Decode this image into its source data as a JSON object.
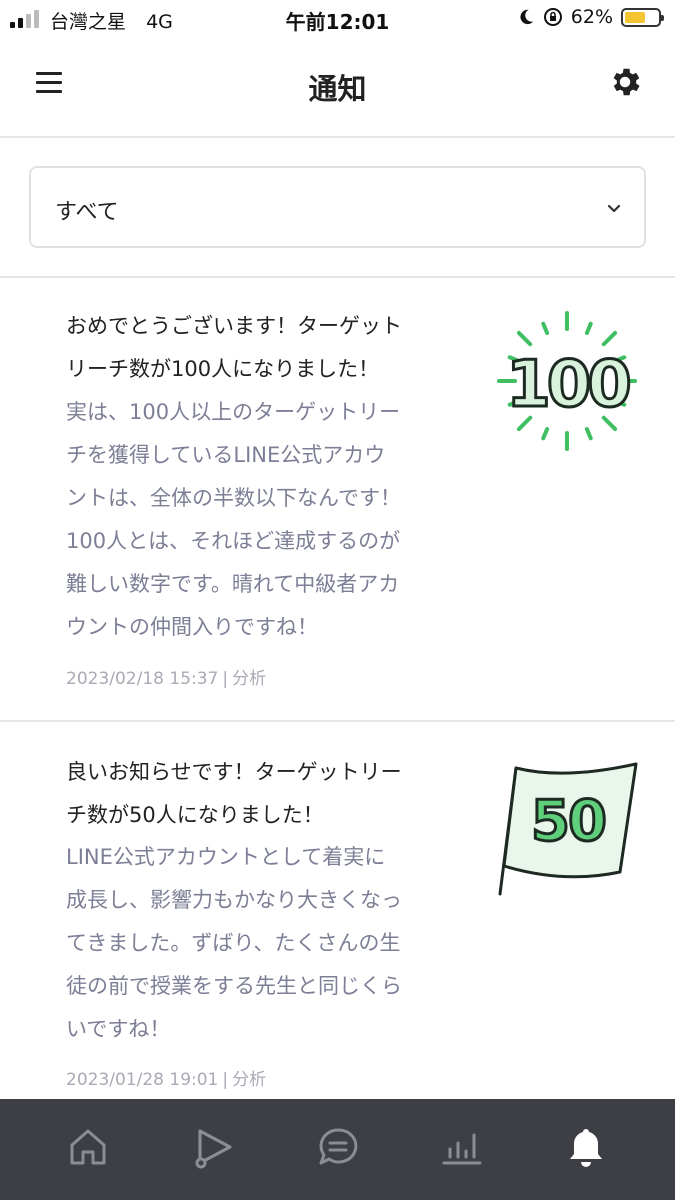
{
  "status_bar": {
    "carrier": "台灣之星",
    "network": "4G",
    "time": "午前12:01",
    "battery_percent": "62%",
    "battery_level": 0.62
  },
  "header": {
    "title": "通知",
    "menu_icon": "hamburger-menu-icon",
    "settings_icon": "gear-icon"
  },
  "filter": {
    "selected": "すべて"
  },
  "notifications": [
    {
      "title_lines": [
        "おめでとうございます！ターゲット",
        "リーチ数が100人になりました！"
      ],
      "body_lines": [
        "実は、100人以上のターゲットリー",
        "チを獲得しているLINE公式アカウ",
        "ントは、全体の半数以下なんです！",
        "100人とは、それほど達成するのが",
        "難しい数字です。晴れて中級者アカ",
        "ウントの仲間入りですね！"
      ],
      "date": "2023/02/18 15:37",
      "category": "分析",
      "badge_text": "100"
    },
    {
      "title_lines": [
        "良いお知らせです！ターゲットリー",
        "チ数が50人になりました！"
      ],
      "body_lines": [
        "LINE公式アカウントとして着実に",
        "成長し、影響力もかなり大きくなっ",
        "てきました。ずばり、たくさんの生",
        "徒の前で授業をする先生と同じくら",
        "いですね！"
      ],
      "date": "2023/01/28 19:01",
      "category": "分析",
      "badge_text": "50"
    }
  ],
  "bottom_nav": {
    "items": [
      {
        "icon": "home-icon",
        "active": false
      },
      {
        "icon": "play-icon",
        "active": false
      },
      {
        "icon": "chat-icon",
        "active": false
      },
      {
        "icon": "analytics-icon",
        "active": false
      },
      {
        "icon": "bell-icon",
        "active": true
      }
    ]
  },
  "colors": {
    "accent_green": "#3fbf62",
    "badge_fill": "#d8f2dc",
    "body_text": "#7c7f96",
    "meta_text": "#a8abb5",
    "nav_background": "#3d3f44"
  }
}
